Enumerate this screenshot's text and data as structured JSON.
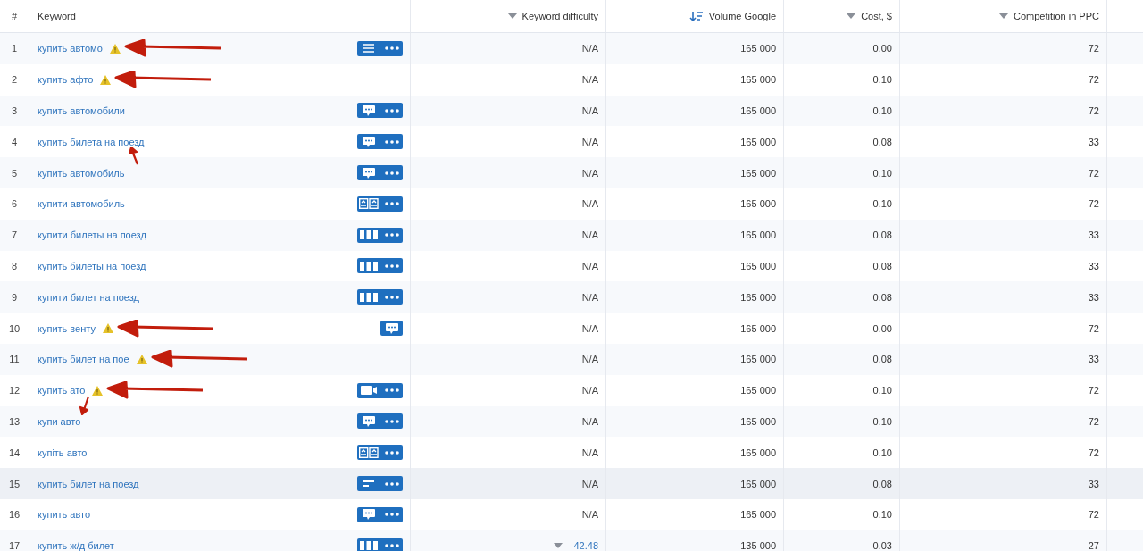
{
  "columns": [
    {
      "label": "#",
      "kind": "plain"
    },
    {
      "label": "Keyword",
      "kind": "plain"
    },
    {
      "label": "Keyword difficulty",
      "kind": "filter"
    },
    {
      "label": "Volume Google",
      "kind": "sorted"
    },
    {
      "label": "Cost, $",
      "kind": "filter"
    },
    {
      "label": "Competition in PPC",
      "kind": "filter"
    }
  ],
  "rows": [
    {
      "num": "1",
      "keyword": "купить автомо",
      "warning": true,
      "arrow": {
        "kind": "left"
      },
      "feature": {
        "kind": "list"
      },
      "more": true,
      "kd": {
        "text": "N/A",
        "kind": "na"
      },
      "volume": "165 000",
      "cost": "0.00",
      "competition": "72",
      "highlighted": false
    },
    {
      "num": "2",
      "keyword": "купить афто",
      "warning": true,
      "arrow": {
        "kind": "left"
      },
      "more": false,
      "kd": {
        "text": "N/A",
        "kind": "na"
      },
      "volume": "165 000",
      "cost": "0.10",
      "competition": "72",
      "highlighted": false
    },
    {
      "num": "3",
      "keyword": "купить автомобили",
      "warning": false,
      "feature": {
        "kind": "chat"
      },
      "more": true,
      "kd": {
        "text": "N/A",
        "kind": "na"
      },
      "volume": "165 000",
      "cost": "0.10",
      "competition": "72",
      "highlighted": false
    },
    {
      "num": "4",
      "keyword": "купить билета на поезд",
      "warning": false,
      "arrow": {
        "kind": "up"
      },
      "feature": {
        "kind": "chat"
      },
      "more": true,
      "kd": {
        "text": "N/A",
        "kind": "na"
      },
      "volume": "165 000",
      "cost": "0.08",
      "competition": "33",
      "highlighted": false
    },
    {
      "num": "5",
      "keyword": "купить автомобиль",
      "warning": false,
      "feature": {
        "kind": "chat"
      },
      "more": true,
      "kd": {
        "text": "N/A",
        "kind": "na"
      },
      "volume": "165 000",
      "cost": "0.10",
      "competition": "72",
      "highlighted": false
    },
    {
      "num": "6",
      "keyword": "купити автомобиль",
      "warning": false,
      "feature": {
        "kind": "cards"
      },
      "more": true,
      "kd": {
        "text": "N/A",
        "kind": "na"
      },
      "volume": "165 000",
      "cost": "0.10",
      "competition": "72",
      "highlighted": false
    },
    {
      "num": "7",
      "keyword": "купити билеты на поезд",
      "warning": false,
      "feature": {
        "kind": "columns"
      },
      "more": true,
      "kd": {
        "text": "N/A",
        "kind": "na"
      },
      "volume": "165 000",
      "cost": "0.08",
      "competition": "33",
      "highlighted": false
    },
    {
      "num": "8",
      "keyword": "купить билеты на поезд",
      "warning": false,
      "feature": {
        "kind": "columns"
      },
      "more": true,
      "kd": {
        "text": "N/A",
        "kind": "na"
      },
      "volume": "165 000",
      "cost": "0.08",
      "competition": "33",
      "highlighted": false
    },
    {
      "num": "9",
      "keyword": "купити билет на поезд",
      "warning": false,
      "feature": {
        "kind": "columns"
      },
      "more": true,
      "kd": {
        "text": "N/A",
        "kind": "na"
      },
      "volume": "165 000",
      "cost": "0.08",
      "competition": "33",
      "highlighted": false
    },
    {
      "num": "10",
      "keyword": "купить венту",
      "warning": true,
      "arrow": {
        "kind": "left"
      },
      "feature": {
        "kind": "chat"
      },
      "more": false,
      "kd": {
        "text": "N/A",
        "kind": "na"
      },
      "volume": "165 000",
      "cost": "0.00",
      "competition": "72",
      "highlighted": false
    },
    {
      "num": "11",
      "keyword": "купить билет на пое",
      "warning": true,
      "arrow": {
        "kind": "left"
      },
      "more": false,
      "kd": {
        "text": "N/A",
        "kind": "na"
      },
      "volume": "165 000",
      "cost": "0.08",
      "competition": "33",
      "highlighted": false
    },
    {
      "num": "12",
      "keyword": "купить ато",
      "warning": true,
      "arrow": {
        "kind": "left-down"
      },
      "feature": {
        "kind": "video"
      },
      "more": true,
      "kd": {
        "text": "N/A",
        "kind": "na"
      },
      "volume": "165 000",
      "cost": "0.10",
      "competition": "72",
      "highlighted": false
    },
    {
      "num": "13",
      "keyword": "купи авто",
      "warning": false,
      "feature": {
        "kind": "chat"
      },
      "more": true,
      "kd": {
        "text": "N/A",
        "kind": "na"
      },
      "volume": "165 000",
      "cost": "0.10",
      "competition": "72",
      "highlighted": false
    },
    {
      "num": "14",
      "keyword": "купіть авто",
      "warning": false,
      "feature": {
        "kind": "cards"
      },
      "more": true,
      "kd": {
        "text": "N/A",
        "kind": "na"
      },
      "volume": "165 000",
      "cost": "0.10",
      "competition": "72",
      "highlighted": false
    },
    {
      "num": "15",
      "keyword": "купить билет на поезд",
      "warning": false,
      "feature": {
        "kind": "text"
      },
      "more": true,
      "kd": {
        "text": "N/A",
        "kind": "na"
      },
      "volume": "165 000",
      "cost": "0.08",
      "competition": "33",
      "highlighted": true
    },
    {
      "num": "16",
      "keyword": "купить авто",
      "warning": false,
      "feature": {
        "kind": "chat"
      },
      "more": true,
      "kd": {
        "text": "N/A",
        "kind": "na"
      },
      "volume": "165 000",
      "cost": "0.10",
      "competition": "72",
      "highlighted": false
    },
    {
      "num": "17",
      "keyword": "купить ж/д билет",
      "warning": false,
      "feature": {
        "kind": "columns"
      },
      "more": true,
      "kd": {
        "text": "42.48",
        "kind": "score"
      },
      "volume": "135 000",
      "cost": "0.03",
      "competition": "27",
      "highlighted": false
    }
  ]
}
